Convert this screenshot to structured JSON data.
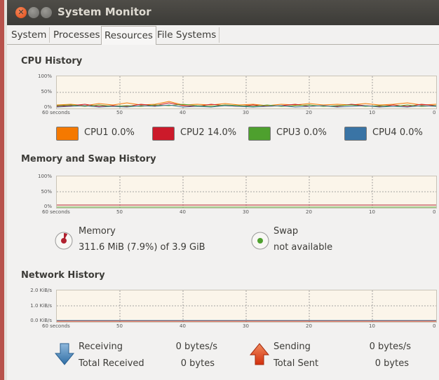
{
  "window": {
    "title": "System Monitor"
  },
  "tabs": [
    {
      "label": "System"
    },
    {
      "label": "Processes"
    },
    {
      "label": "Resources"
    },
    {
      "label": "File Systems"
    }
  ],
  "cpu": {
    "title": "CPU History",
    "y_ticks": [
      "100%",
      "50%",
      "0%"
    ],
    "x_ticks": [
      "60 seconds",
      "50",
      "40",
      "30",
      "20",
      "10",
      "0"
    ],
    "legend": [
      {
        "label": "CPU1  0.0%",
        "color": "#f57900"
      },
      {
        "label": "CPU2  14.0%",
        "color": "#cc1a2a"
      },
      {
        "label": "CPU3  0.0%",
        "color": "#4ea02e"
      },
      {
        "label": "CPU4  0.0%",
        "color": "#3a74a5"
      }
    ]
  },
  "memory": {
    "title": "Memory and Swap History",
    "y_ticks": [
      "100%",
      "50%",
      "0%"
    ],
    "x_ticks": [
      "60 seconds",
      "50",
      "40",
      "30",
      "20",
      "10",
      "0"
    ],
    "memory_label": "Memory",
    "memory_value": "311.6 MiB (7.9%) of 3.9 GiB",
    "memory_percent": 7.9,
    "memory_color": "#b0212e",
    "swap_label": "Swap",
    "swap_value": "not available",
    "swap_color": "#4ea02e"
  },
  "network": {
    "title": "Network History",
    "y_ticks": [
      "2.0 KiB/s",
      "1.0 KiB/s",
      "0.0 KiB/s"
    ],
    "x_ticks": [
      "60 seconds",
      "50",
      "40",
      "30",
      "20",
      "10",
      "0"
    ],
    "receiving_label": "Receiving",
    "receiving_value": "0 bytes/s",
    "total_received_label": "Total Received",
    "total_received_value": "0 bytes",
    "sending_label": "Sending",
    "sending_value": "0 bytes/s",
    "total_sent_label": "Total Sent",
    "total_sent_value": "0 bytes",
    "receiving_color": "#3a74a5",
    "sending_color": "#e2401c"
  }
}
